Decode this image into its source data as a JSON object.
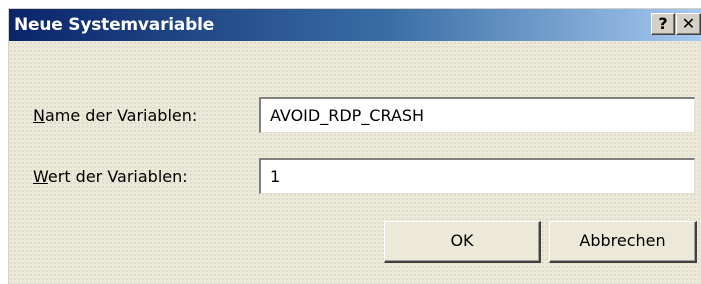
{
  "dialog": {
    "title": "Neue Systemvariable",
    "help_button": "?",
    "close_button": "✕"
  },
  "fields": {
    "name": {
      "label_access_key": "N",
      "label_rest": "ame der Variablen:",
      "value": "AVOID_RDP_CRASH"
    },
    "value": {
      "label_access_key": "W",
      "label_rest": "ert der Variablen:",
      "value": "1"
    }
  },
  "buttons": {
    "ok": "OK",
    "cancel": "Abbrechen"
  }
}
